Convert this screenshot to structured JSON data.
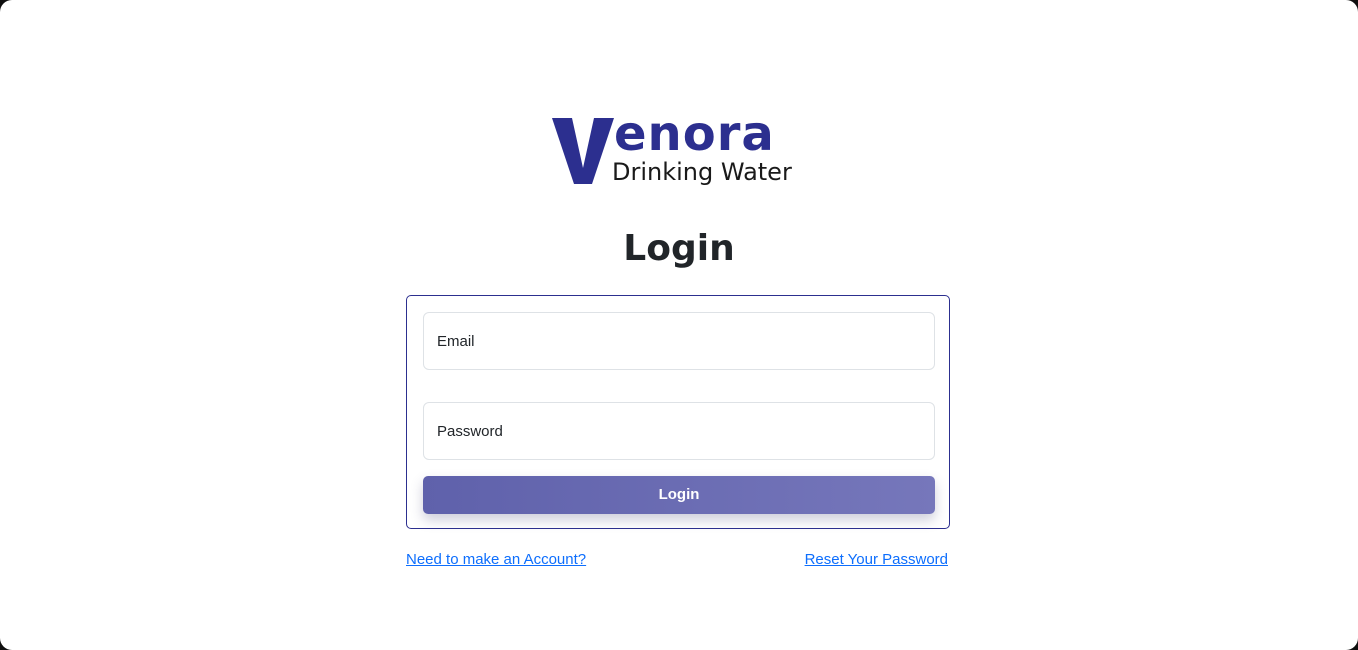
{
  "brand": {
    "name": "enora",
    "initial": "V",
    "tagline": "Drinking Water",
    "color": "#2c2f8f"
  },
  "page": {
    "title": "Login"
  },
  "form": {
    "email_label": "Email",
    "password_label": "Password",
    "submit_label": "Login",
    "button_gradient": [
      "#5f61ab",
      "#7677bb"
    ]
  },
  "links": {
    "signup": "Need to make an Account?",
    "reset": "Reset Your Password",
    "color": "#0d6efd"
  }
}
